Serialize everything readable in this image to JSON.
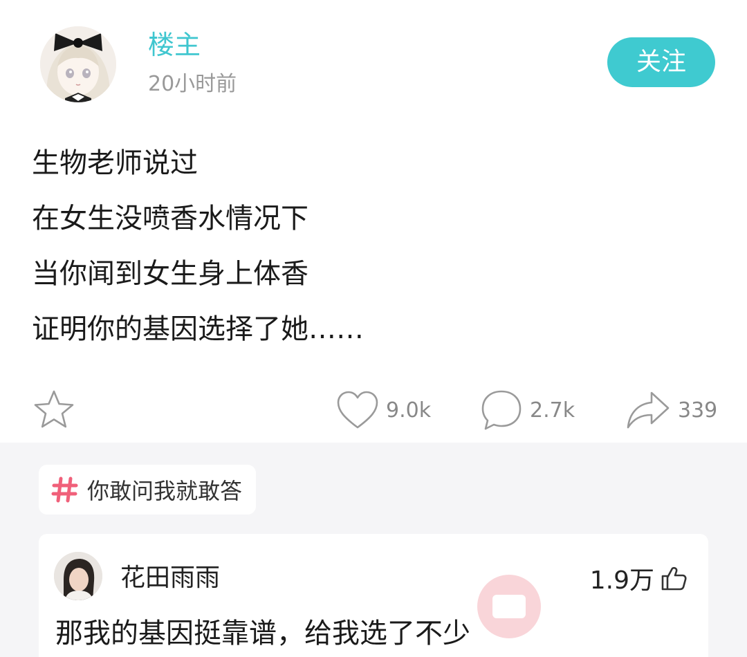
{
  "post": {
    "author": "楼主",
    "time": "20小时前",
    "follow_label": "关注",
    "lines": [
      "生物老师说过",
      "在女生没喷香水情况下",
      "当你闻到女生身上体香",
      "证明你的基因选择了她……"
    ],
    "actions": {
      "favorite_icon": "star-icon",
      "like_icon": "heart-icon",
      "like_count": "9.0k",
      "comment_icon": "comment-bubble-icon",
      "comment_count": "2.7k",
      "share_icon": "share-arrow-icon",
      "share_count": "339"
    }
  },
  "topic": {
    "icon": "hashtag-icon",
    "label": "你敢问我就敢答"
  },
  "comment": {
    "user": "花田雨雨",
    "like_count": "1.9万",
    "like_icon": "thumbs-up-icon",
    "text": "那我的基因挺靠谱，给我选了不少"
  },
  "colors": {
    "accent": "#3fc6cf",
    "hashtag": "#f0607a",
    "muted": "#999999",
    "page_bg": "#f5f5f7"
  }
}
